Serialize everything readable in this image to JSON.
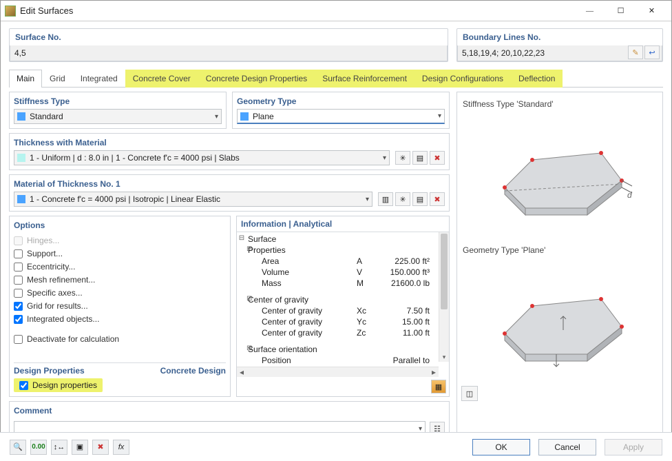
{
  "window": {
    "title": "Edit Surfaces"
  },
  "surface_no": {
    "label": "Surface No.",
    "value": "4,5"
  },
  "boundary": {
    "label": "Boundary Lines No.",
    "value": "5,18,19,4; 20,10,22,23"
  },
  "tabs": [
    "Main",
    "Grid",
    "Integrated",
    "Concrete Cover",
    "Concrete Design Properties",
    "Surface Reinforcement",
    "Design Configurations",
    "Deflection"
  ],
  "stiffness": {
    "label": "Stiffness Type",
    "value": "Standard"
  },
  "geometry": {
    "label": "Geometry Type",
    "value": "Plane"
  },
  "thickness_material": {
    "label": "Thickness with Material",
    "value": "1 - Uniform | d : 8.0 in | 1 - Concrete f'c = 4000 psi | Slabs"
  },
  "material_thickness": {
    "label": "Material of Thickness No. 1",
    "value": "1 - Concrete f'c = 4000 psi | Isotropic | Linear Elastic"
  },
  "options": {
    "label": "Options",
    "items": [
      {
        "label": "Hinges...",
        "checked": false,
        "disabled": true
      },
      {
        "label": "Support...",
        "checked": false,
        "disabled": false
      },
      {
        "label": "Eccentricity...",
        "checked": false,
        "disabled": false
      },
      {
        "label": "Mesh refinement...",
        "checked": false,
        "disabled": false
      },
      {
        "label": "Specific axes...",
        "checked": false,
        "disabled": false
      },
      {
        "label": "Grid for results...",
        "checked": true,
        "disabled": false
      },
      {
        "label": "Integrated objects...",
        "checked": true,
        "disabled": false
      },
      {
        "label": "Deactivate for calculation",
        "checked": false,
        "disabled": false
      }
    ]
  },
  "design_props": {
    "label1": "Design Properties",
    "label2": "Concrete Design",
    "check_label": "Design properties"
  },
  "info": {
    "label": "Information | Analytical",
    "rows": [
      {
        "exp": "⊟",
        "lbl": "Surface",
        "ind": "",
        "sym": "",
        "val": ""
      },
      {
        "exp": "⊟",
        "lbl": "Properties",
        "ind": "ind1",
        "sym": "",
        "val": ""
      },
      {
        "exp": "",
        "lbl": "Area",
        "ind": "ind2",
        "sym": "A",
        "val": "225.00 ft²"
      },
      {
        "exp": "",
        "lbl": "Volume",
        "ind": "ind2",
        "sym": "V",
        "val": "150.000 ft³"
      },
      {
        "exp": "",
        "lbl": "Mass",
        "ind": "ind2",
        "sym": "M",
        "val": "21600.0 lb"
      },
      {
        "exp": "⊟",
        "lbl": "Center of gravity",
        "ind": "ind1",
        "sym": "",
        "val": ""
      },
      {
        "exp": "",
        "lbl": "Center of gravity",
        "ind": "ind2",
        "sym": "Xc",
        "val": "7.50 ft"
      },
      {
        "exp": "",
        "lbl": "Center of gravity",
        "ind": "ind2",
        "sym": "Yc",
        "val": "15.00 ft"
      },
      {
        "exp": "",
        "lbl": "Center of gravity",
        "ind": "ind2",
        "sym": "Zc",
        "val": "11.00 ft"
      },
      {
        "exp": "⊟",
        "lbl": "Surface orientation",
        "ind": "ind1",
        "sym": "",
        "val": ""
      },
      {
        "exp": "",
        "lbl": "Position",
        "ind": "ind2",
        "sym": "",
        "val": "Parallel to plane"
      }
    ]
  },
  "comment": {
    "label": "Comment"
  },
  "preview": {
    "stiff_label": "Stiffness Type 'Standard'",
    "geom_label": "Geometry Type 'Plane'"
  },
  "buttons": {
    "ok": "OK",
    "cancel": "Cancel",
    "apply": "Apply"
  }
}
